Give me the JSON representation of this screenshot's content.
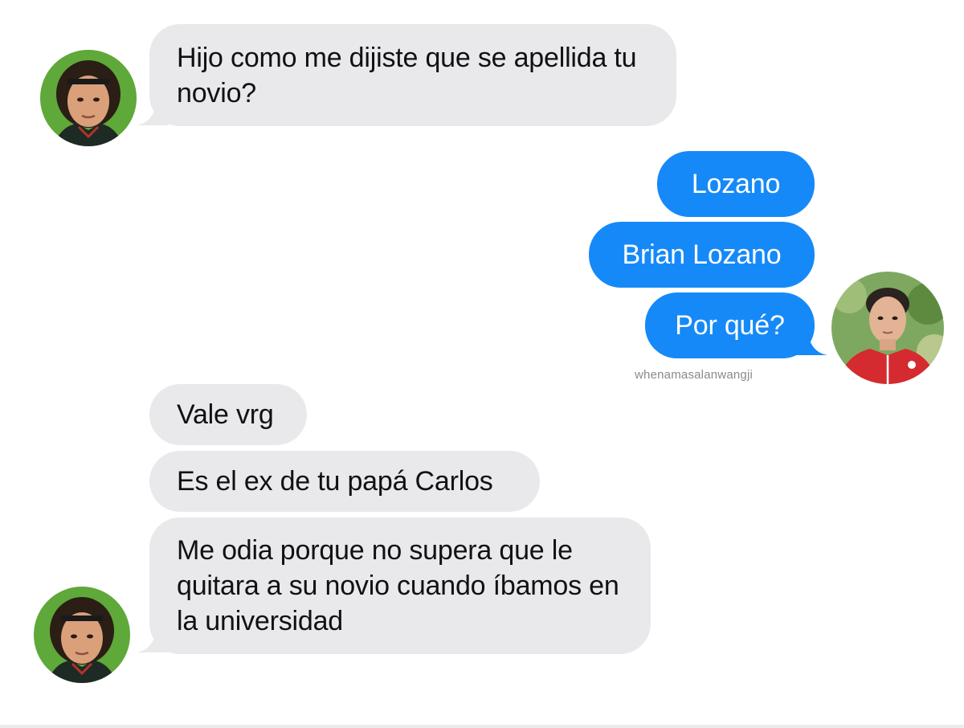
{
  "conversation": {
    "messages": [
      {
        "sender": "mom",
        "text": "Hijo como me dijiste que se apellida tu novio?"
      },
      {
        "sender": "me",
        "text": "Lozano"
      },
      {
        "sender": "me",
        "text": "Brian Lozano"
      },
      {
        "sender": "me",
        "text": "Por qué?"
      },
      {
        "sender": "mom",
        "text": "Vale vrg"
      },
      {
        "sender": "mom",
        "text": "Es el ex de tu papá Carlos"
      },
      {
        "sender": "mom",
        "text": "Me odia porque no supera que le quitara a su novio cuando íbamos en la universidad"
      }
    ]
  },
  "watermark": "whenamasalanwangji",
  "colors": {
    "incoming_bubble": "#e9e9ec",
    "outgoing_bubble": "#1689f8",
    "mom_avatar_bg": "#5fa83a",
    "son_avatar_bg": "#6f9a55"
  },
  "avatars": {
    "mom": "goalkeeper-portrait-avatar",
    "son": "young-man-red-jersey-avatar"
  }
}
